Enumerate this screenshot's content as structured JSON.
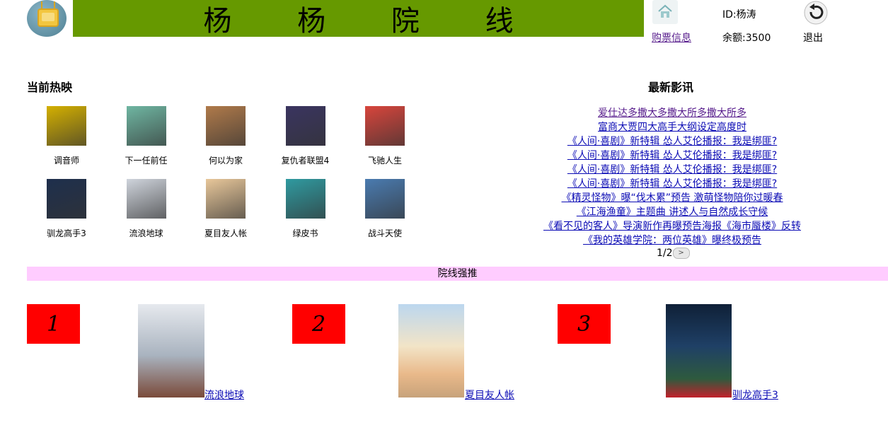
{
  "header": {
    "title": "杨 杨 院 线",
    "user_id": "ID:杨涛",
    "purchase_info": "购票信息",
    "balance": "余额:3500",
    "logout": "退出"
  },
  "now_showing": {
    "title": "当前热映",
    "movies": [
      {
        "name": "调音师",
        "color": "#d4b000"
      },
      {
        "name": "下一任前任",
        "color": "#6fb6a2"
      },
      {
        "name": "何以为家",
        "color": "#b07a4a"
      },
      {
        "name": "复仇者联盟4",
        "color": "#3a3460"
      },
      {
        "name": "飞驰人生",
        "color": "#d8453c"
      },
      {
        "name": "驯龙高手3",
        "color": "#1e2f4d"
      },
      {
        "name": "流浪地球",
        "color": "#cfd4dc"
      },
      {
        "name": "夏目友人帐",
        "color": "#e8c79a"
      },
      {
        "name": "绿皮书",
        "color": "#2f9aa0"
      },
      {
        "name": "战斗天使",
        "color": "#4a7bb0"
      }
    ]
  },
  "news": {
    "title": "最新影讯",
    "items": [
      "爱仕达多撒大多撒大所多撒大所多",
      "富商大贾四大高手大纲设定高度时",
      "《人间·喜剧》新特辑 怂人艾伦播报：我是绑匪?",
      "《人间·喜剧》新特辑 怂人艾伦播报：我是绑匪?",
      "《人间·喜剧》新特辑 怂人艾伦播报：我是绑匪?",
      "《人间·喜剧》新特辑 怂人艾伦播报：我是绑匪?",
      "《精灵怪物》曝“伐木累”预告 激萌怪物陪你过暖春",
      "《江海渔童》主题曲 讲述人与自然成长守候",
      "《看不见的客人》导演新作再曝预告海报《海市蜃楼》反转",
      "《我的英雄学院：两位英雄》曝终极预告"
    ],
    "pager": "1/2"
  },
  "promo": {
    "bar_label": "院线强推",
    "items": [
      {
        "rank": "1",
        "name": "流浪地球",
        "color": "#b9c0c9"
      },
      {
        "rank": "2",
        "name": "夏目友人帐",
        "color": "#c9dcef"
      },
      {
        "rank": "3",
        "name": "驯龙高手3",
        "color": "#1d3550"
      }
    ]
  }
}
